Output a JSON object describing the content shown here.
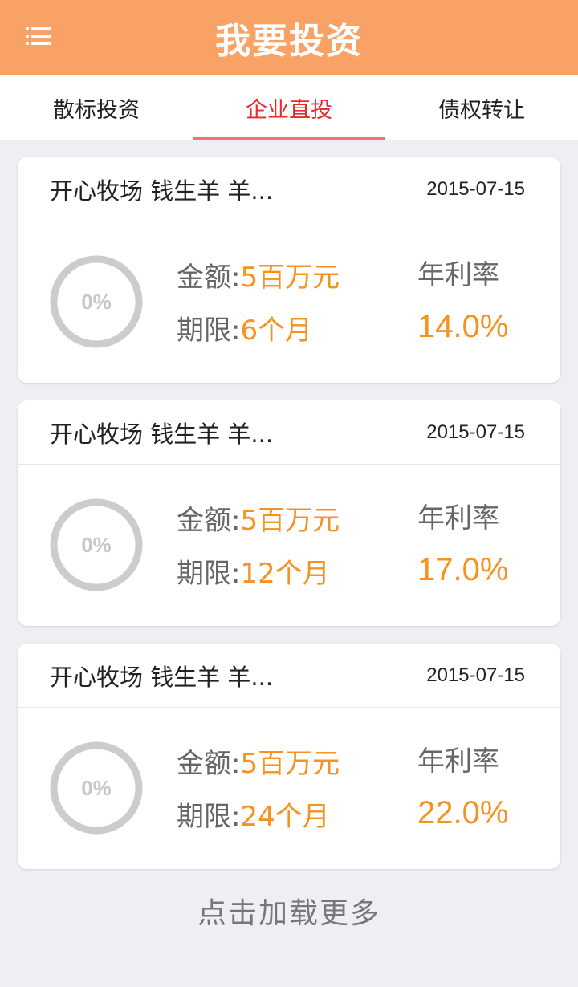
{
  "header": {
    "title": "我要投资",
    "menu_icon": "menu-icon"
  },
  "tabs": [
    {
      "label": "散标投资",
      "active": false
    },
    {
      "label": "企业直投",
      "active": true
    },
    {
      "label": "债权转让",
      "active": false
    }
  ],
  "colors": {
    "header_bg": "#f9a266",
    "accent_orange": "#f59220",
    "tab_active": "#e8282b"
  },
  "projects": [
    {
      "title": "开心牧场  钱生羊 羊...",
      "date": "2015-07-15",
      "progress_text": "0%",
      "progress": 0,
      "amount_label": "金额:",
      "amount": "5百万元",
      "term_label": "期限:",
      "term": "6个月",
      "rate_label": "年利率",
      "rate": "14.0%"
    },
    {
      "title": "开心牧场 钱生羊 羊...",
      "date": "2015-07-15",
      "progress_text": "0%",
      "progress": 0,
      "amount_label": "金额:",
      "amount": "5百万元",
      "term_label": "期限:",
      "term": "12个月",
      "rate_label": "年利率",
      "rate": "17.0%"
    },
    {
      "title": "开心牧场 钱生羊 羊...",
      "date": "2015-07-15",
      "progress_text": "0%",
      "progress": 0,
      "amount_label": "金额:",
      "amount": "5百万元",
      "term_label": "期限:",
      "term": "24个月",
      "rate_label": "年利率",
      "rate": "22.0%"
    }
  ],
  "load_more": "点击加载更多"
}
